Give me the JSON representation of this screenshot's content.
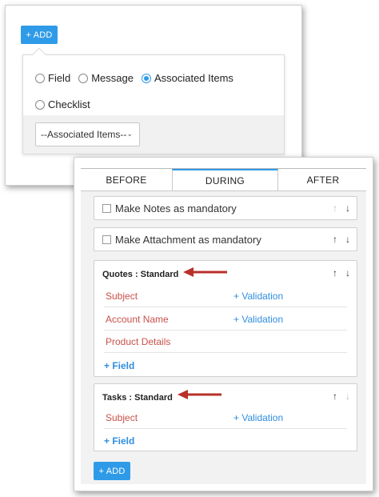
{
  "top": {
    "add_button_label": "+ ADD",
    "radio_options": [
      {
        "label": "Field",
        "checked": false
      },
      {
        "label": "Message",
        "checked": false
      },
      {
        "label": "Associated Items",
        "checked": true
      },
      {
        "label": "Checklist",
        "checked": false
      }
    ],
    "select_value": "--Associated Items--"
  },
  "tabs": [
    {
      "label": "BEFORE",
      "active": false
    },
    {
      "label": "DURING",
      "active": true
    },
    {
      "label": "AFTER",
      "active": false
    }
  ],
  "checkbox_items": [
    {
      "label": "Make Notes as mandatory",
      "up_enabled": false,
      "down_enabled": true
    },
    {
      "label": "Make Attachment as mandatory",
      "up_enabled": true,
      "down_enabled": true
    }
  ],
  "sections": [
    {
      "title": "Quotes : Standard",
      "up_enabled": true,
      "down_enabled": true,
      "fields": [
        {
          "name": "Subject",
          "action": "+ Validation"
        },
        {
          "name": "Account Name",
          "action": "+ Validation"
        },
        {
          "name": "Product Details",
          "action": ""
        }
      ],
      "add_field_label": "+ Field"
    },
    {
      "title": "Tasks : Standard",
      "up_enabled": true,
      "down_enabled": false,
      "fields": [
        {
          "name": "Subject",
          "action": "+ Validation"
        }
      ],
      "add_field_label": "+ Field"
    }
  ],
  "bottom_add_label": "+ ADD",
  "icons": {
    "up": "↑",
    "down": "↓",
    "chevron": "⌄"
  },
  "colors": {
    "accent": "#2f9be8",
    "field_name": "#c9514a",
    "arrow": "#b8312a"
  }
}
